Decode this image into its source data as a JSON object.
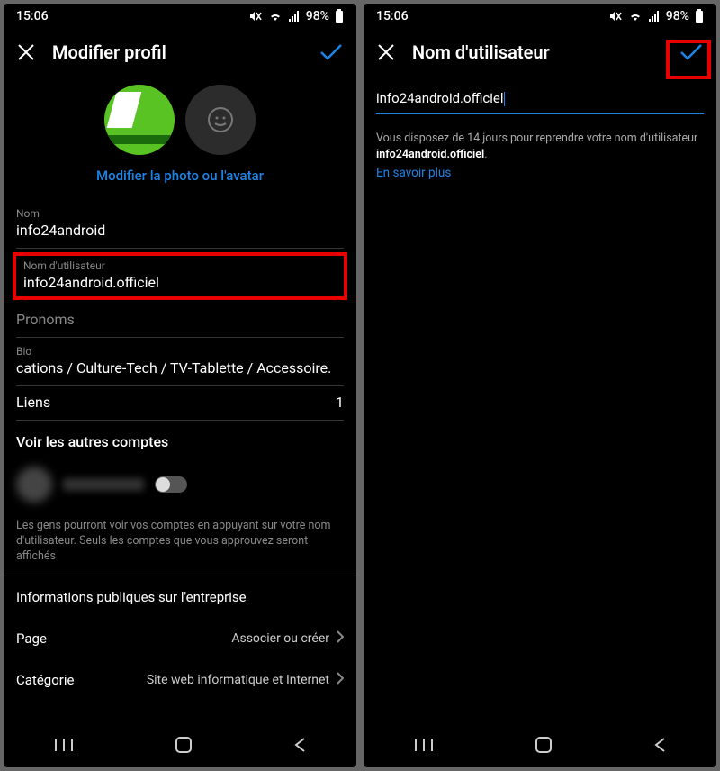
{
  "status": {
    "time": "15:06",
    "battery": "98%"
  },
  "left": {
    "header_title": "Modifier profil",
    "modify_photo": "Modifier la photo ou l'avatar",
    "fields": {
      "name_label": "Nom",
      "name_value": "info24android",
      "username_label": "Nom d'utilisateur",
      "username_value": "info24android.officiel",
      "pronouns_label": "Pronoms",
      "bio_label": "Bio",
      "bio_value": "cations / Culture-Tech / TV-Tablette / Accessoire.",
      "links_label": "Liens",
      "links_count": "1"
    },
    "other_accounts_title": "Voir les autres comptes",
    "other_accounts_hint": "Les gens pourront voir vos comptes en appuyant sur votre nom d'utilisateur. Seuls les comptes que vous approuvez seront affichés",
    "business_section": "Informations publiques sur l'entreprise",
    "page_label": "Page",
    "page_value": "Associer ou créer",
    "category_label": "Catégorie",
    "category_value": "Site web informatique et Internet"
  },
  "right": {
    "header_title": "Nom d'utilisateur",
    "input_value": "info24android.officiel",
    "info_prefix": "Vous disposez de 14 jours pour reprendre votre nom d'utilisateur ",
    "info_bold": "info24android.officiel",
    "info_suffix": ".",
    "learn_more": "En savoir plus"
  }
}
